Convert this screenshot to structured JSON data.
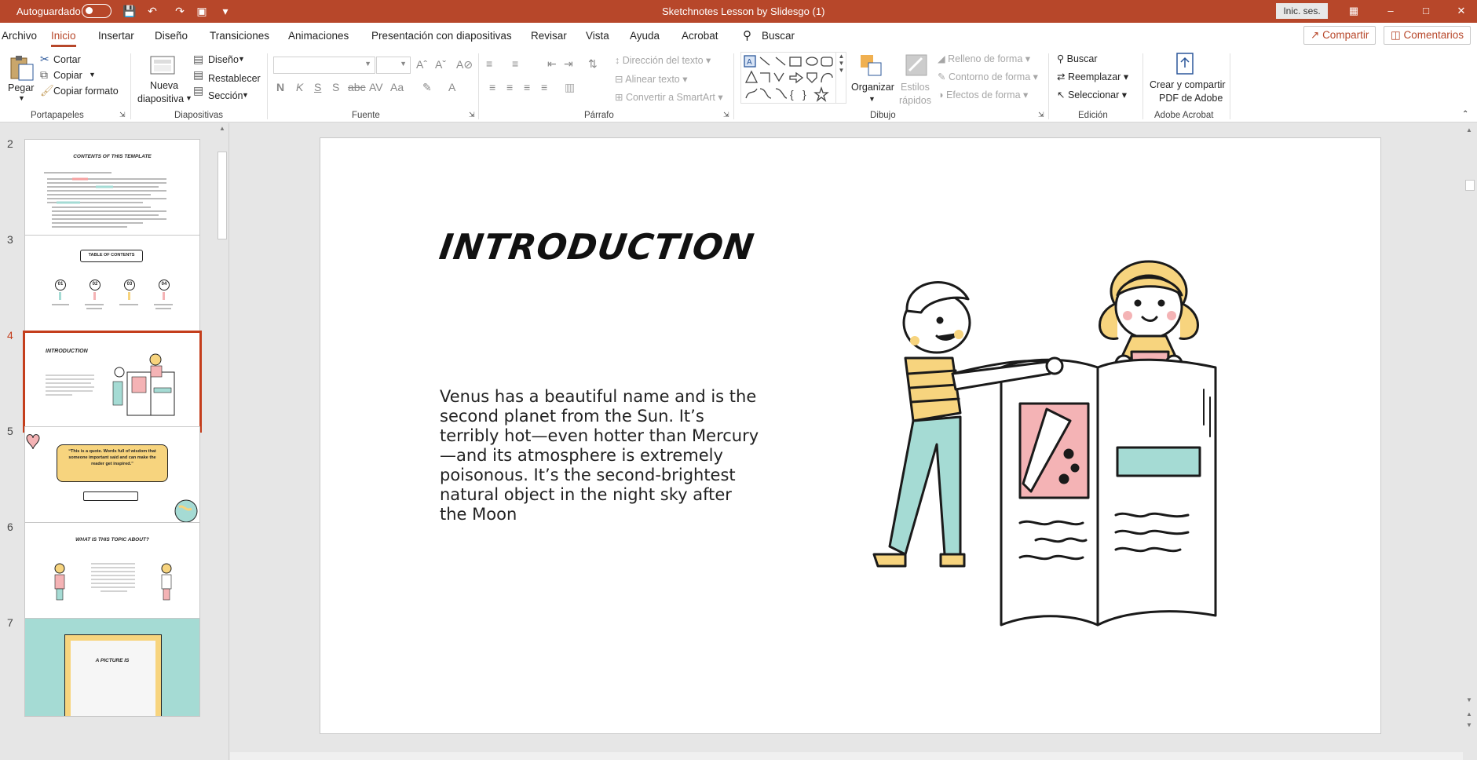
{
  "titlebar": {
    "autosave_label": "Autoguardado",
    "doc_title": "Sketchnotes Lesson by Slidesgo (1)",
    "signin_label": "Inic. ses.",
    "bg_color": "#b7472a"
  },
  "menu": {
    "tabs": [
      "Archivo",
      "Inicio",
      "Insertar",
      "Diseño",
      "Transiciones",
      "Animaciones",
      "Presentación con diapositivas",
      "Revisar",
      "Vista",
      "Ayuda",
      "Acrobat"
    ],
    "active_tab": "Inicio",
    "search_label": "Buscar",
    "share_label": "Compartir",
    "comments_label": "Comentarios"
  },
  "ribbon": {
    "clipboard": {
      "paste": "Pegar",
      "cut": "Cortar",
      "copy": "Copiar",
      "format": "Copiar formato",
      "group": "Portapapeles"
    },
    "slides": {
      "new": "Nueva",
      "new2": "diapositiva",
      "layout": "Diseño",
      "reset": "Restablecer",
      "section": "Sección",
      "group": "Diapositivas"
    },
    "font": {
      "group": "Fuente"
    },
    "paragraph": {
      "text_dir": "Dirección del texto",
      "align_text": "Alinear texto",
      "smartart": "Convertir a SmartArt",
      "group": "Párrafo"
    },
    "drawing": {
      "arrange": "Organizar",
      "quick1": "Estilos",
      "quick2": "rápidos",
      "fill": "Relleno de forma",
      "outline": "Contorno de forma",
      "effects": "Efectos de forma",
      "group": "Dibujo"
    },
    "editing": {
      "find": "Buscar",
      "replace": "Reemplazar",
      "select": "Seleccionar",
      "group": "Edición"
    },
    "acrobat": {
      "create1": "Crear y compartir",
      "create2": "PDF de Adobe",
      "group": "Adobe Acrobat"
    }
  },
  "thumbnails": [
    {
      "num": "2",
      "title": "CONTENTS OF THIS TEMPLATE"
    },
    {
      "num": "3",
      "title": "TABLE OF CONTENTS",
      "items": [
        "01",
        "02",
        "03",
        "04"
      ]
    },
    {
      "num": "4",
      "title": "INTRODUCTION",
      "selected": true
    },
    {
      "num": "5",
      "title": "“This is a quote. Words full of wisdom that someone important said and can make the reader get inspired.”"
    },
    {
      "num": "6",
      "title": "WHAT IS THIS TOPIC ABOUT?"
    },
    {
      "num": "7",
      "title": "A PICTURE IS"
    }
  ],
  "slide": {
    "title": "INTRODUCTION",
    "body": "Venus has a beautiful name and is the second planet from the Sun. It’s terribly hot—even hotter than Mercury—and its atmosphere is extremely poisonous. It’s the second-brightest natural object in the night sky after the Moon"
  },
  "colors": {
    "accent": "#b7472a",
    "selection": "#c43e1c",
    "pink": "#f4b3b5",
    "teal": "#a5dbd4",
    "yellow": "#f7d47e"
  }
}
